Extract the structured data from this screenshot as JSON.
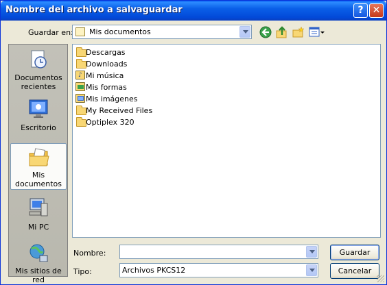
{
  "window": {
    "title": "Nombre del archivo a salvaguardar",
    "help_glyph": "?",
    "close_glyph": "✕"
  },
  "toolbar": {
    "save_in_label": "Guardar en:",
    "save_in_value": "Mis documentos",
    "icons": [
      "back-icon",
      "up-folder-icon",
      "new-folder-icon",
      "view-menu-icon"
    ]
  },
  "places": [
    {
      "label": "Documentos recientes",
      "icon": "recent-documents-icon"
    },
    {
      "label": "Escritorio",
      "icon": "desktop-icon"
    },
    {
      "label": "Mis documentos",
      "icon": "my-documents-icon",
      "selected": true
    },
    {
      "label": "Mi PC",
      "icon": "my-computer-icon"
    },
    {
      "label": "Mis sitios de red",
      "icon": "network-places-icon"
    }
  ],
  "files": [
    {
      "name": "Descargas",
      "icon": "folder-icon"
    },
    {
      "name": "Downloads",
      "icon": "folder-icon"
    },
    {
      "name": "Mi música",
      "icon": "music-folder-icon"
    },
    {
      "name": "Mis formas",
      "icon": "shapes-folder-icon"
    },
    {
      "name": "Mis imágenes",
      "icon": "pictures-folder-icon"
    },
    {
      "name": "My Received Files",
      "icon": "folder-icon"
    },
    {
      "name": "Optiplex 320",
      "icon": "folder-icon"
    }
  ],
  "form": {
    "name_label": "Nombre:",
    "name_value": "",
    "type_label": "Tipo:",
    "type_value": "Archivos PKCS12"
  },
  "buttons": {
    "save": "Guardar",
    "cancel": "Cancelar"
  },
  "colors": {
    "titlebar": "#0a5fe8",
    "dialog_bg": "#ece9d8",
    "folder": "#f8d775",
    "accent_border": "#7f9db9"
  }
}
